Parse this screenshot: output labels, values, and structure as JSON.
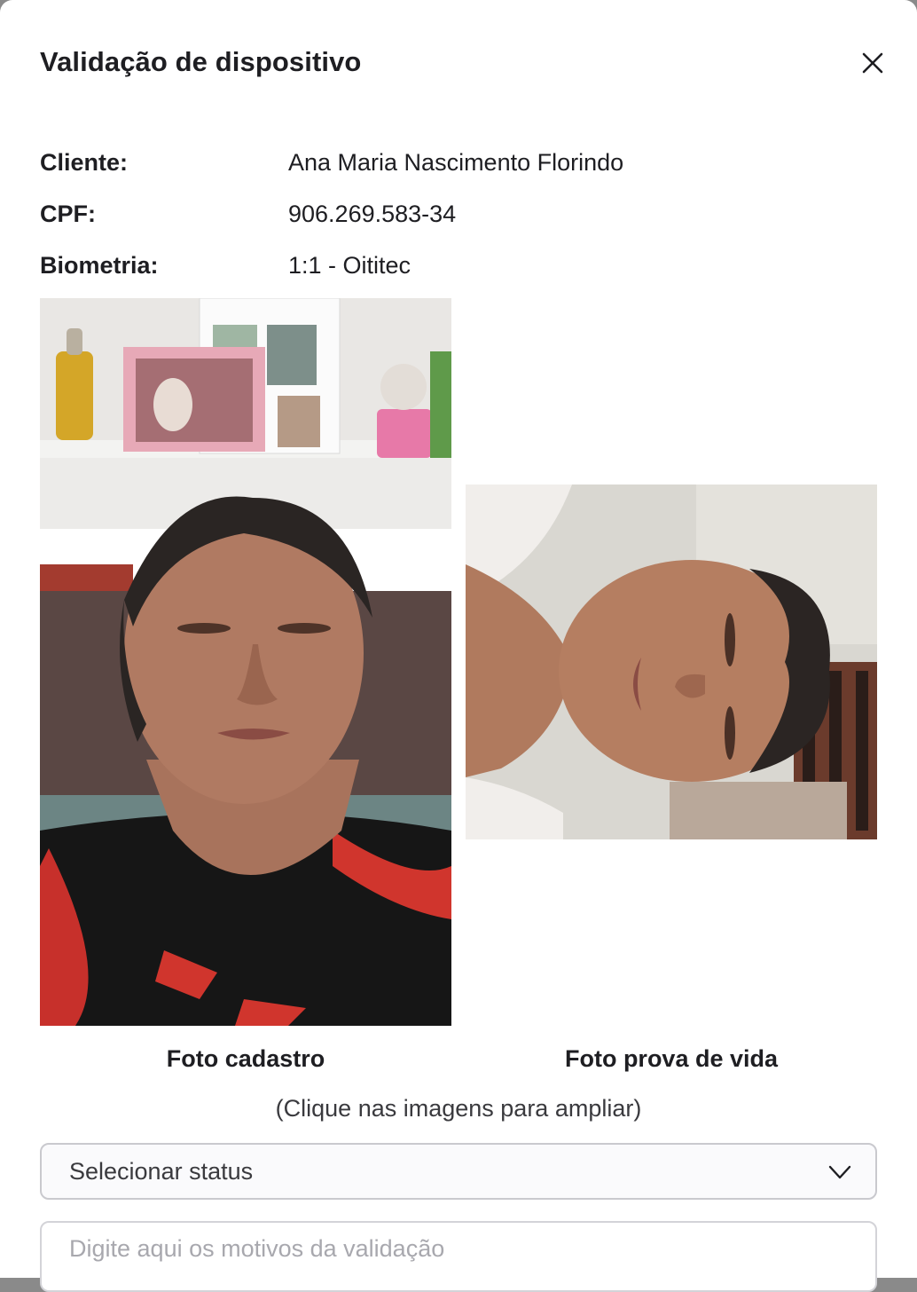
{
  "modal": {
    "title": "Validação de dispositivo",
    "close_icon": "close-icon"
  },
  "client_info": {
    "client_label": "Cliente:",
    "client_value": "Ana Maria Nascimento Florindo",
    "cpf_label": "CPF:",
    "cpf_value": "906.269.583-34",
    "biometry_label": "Biometria:",
    "biometry_value": "1:1 - Oititec"
  },
  "photos": {
    "registration_caption": "Foto cadastro",
    "liveness_caption": "Foto prova de vida",
    "hint": "(Clique nas imagens para ampliar)"
  },
  "status_select": {
    "value": "Selecionar status",
    "icon": "chevron-down-icon"
  },
  "reasons_field": {
    "placeholder": "Digite aqui os motivos da validação",
    "value": ""
  }
}
